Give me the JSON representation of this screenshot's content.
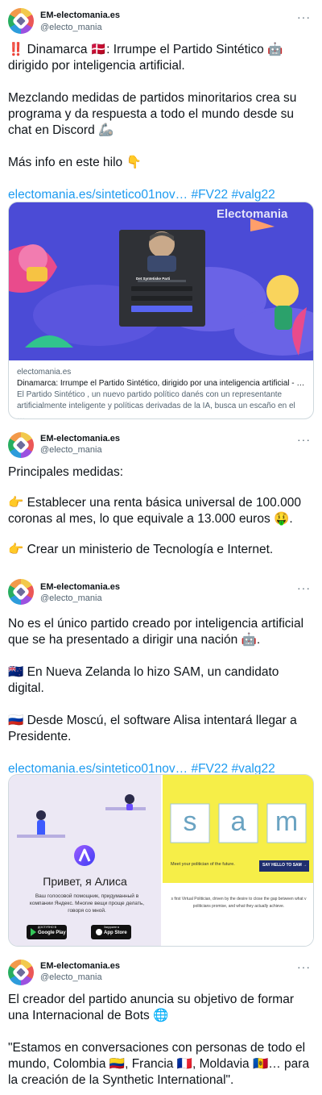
{
  "tweets": [
    {
      "user": "EM-electomania.es",
      "handle": "@electo_mania",
      "more": "···",
      "text": [
        "‼️ Dinamarca 🇩🇰: Irrumpe el Partido Sintético 🤖 dirigido por inteligencia artificial.",
        "Mezclando medidas de partidos minoritarios crea su programa y da respuesta a todo el mundo desde su chat en Discord 🦾",
        "Más info en este hilo 👇"
      ],
      "link": "electomania.es/sintetico01nov…",
      "hashtags": "#FV22 #valg22",
      "card": {
        "brand": "Electomania",
        "party_name": "Det Syntetiske Parti",
        "domain": "electomania.es",
        "title": "Dinamarca: Irrumpe el Partido Sintético, dirigido por una inteligencia artificial - …",
        "description": "El Partido Sintético , un nuevo partido político danés con un representante artificialmente inteligente y políticas derivadas de la IA, busca un escaño en el …"
      }
    },
    {
      "user": "EM-electomania.es",
      "handle": "@electo_mania",
      "more": "···",
      "heading": "Principales medidas:",
      "items": [
        "👉 Establecer una renta básica universal de 100.000 coronas al mes, lo que equivale a 13.000 euros 🤑.",
        "👉 Crear un ministerio de Tecnología e Internet."
      ]
    },
    {
      "user": "EM-electomania.es",
      "handle": "@electo_mania",
      "more": "···",
      "text": [
        "No es el único partido creado por inteligencia artificial que se ha presentado a dirigir una nación 🤖.",
        "🇳🇿 En Nueva Zelanda lo hizo SAM, un candidato digital.",
        "🇷🇺 Desde Moscú, el software Alisa intentará llegar a Presidente."
      ],
      "link": "electomania.es/sintetico01nov…",
      "hashtags": "#FV22 #valg22",
      "alisa": {
        "greeting": "Привет, я Алиса",
        "sub": "Ваш голосовой помощник, придуманный в компании Яндекс. Многие вещи проще делать, говоря со мной.",
        "google_play": "Google Play",
        "app_store": "App Store",
        "gp_small": "ДОСТУПНО В",
        "as_small": "Загрузите в"
      },
      "sam": {
        "letters": [
          "s",
          "a",
          "m"
        ],
        "tagline": "Meet your politician of the future.",
        "button": "SAY HELLO TO SAM →",
        "desc": "s first Virtual Politician, driven by the desire to close the gap between what v politicians promise, and what they actually achieve."
      }
    },
    {
      "user": "EM-electomania.es",
      "handle": "@electo_mania",
      "more": "···",
      "text": [
        "El creador del partido anuncia su objetivo de formar una Internacional de Bots 🌐",
        "\"Estamos en conversaciones con personas de todo el mundo, Colombia 🇨🇴, Francia 🇫🇷, Moldavia 🇲🇩… para la creación de la Synthetic International\"."
      ]
    }
  ]
}
